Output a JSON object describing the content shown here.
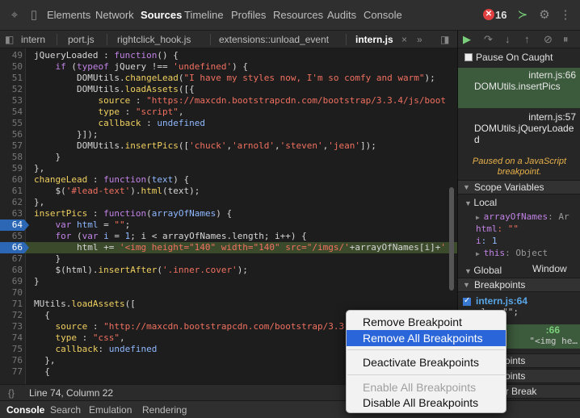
{
  "toolbar": {
    "tabs": [
      "Elements",
      "Network",
      "Sources",
      "Timeline",
      "Profiles",
      "Resources",
      "Audits",
      "Console"
    ],
    "active_tab": "Sources",
    "error_count": "16"
  },
  "file_tabs": [
    "intern",
    "port.js",
    "rightclick_hook.js",
    "extensions::unload_event",
    "intern.js"
  ],
  "active_file": "intern.js",
  "editor": {
    "lines": [
      {
        "n": "49",
        "html": "<span class='m'>jQueryLoaded</span> : <span class='k'>function</span>() {"
      },
      {
        "n": "50",
        "html": "    <span class='k'>if</span> (<span class='k'>typeof</span> jQuery !== <span class='s'>'undefined'</span>) {"
      },
      {
        "n": "51",
        "html": "        DOMUtils.<span class='p'>changeLead</span>(<span class='s'>\"I have my styles now, I'm so comfy and warm\"</span>);"
      },
      {
        "n": "52",
        "html": "        DOMUtils.<span class='p'>loadAssets</span>([{"
      },
      {
        "n": "53",
        "html": "            <span class='p'>source</span> : <span class='s'>\"https://maxcdn.bootstrapcdn.com/bootstrap/3.3.4/js/boot</span>"
      },
      {
        "n": "54",
        "html": "            <span class='p'>type</span> : <span class='s'>\"script\"</span>,"
      },
      {
        "n": "55",
        "html": "            <span class='p'>callback</span> : <span class='v'>undefined</span>"
      },
      {
        "n": "56",
        "html": "        }]);"
      },
      {
        "n": "57",
        "html": "        DOMUtils.<span class='p'>insertPics</span>([<span class='s'>'chuck'</span>,<span class='s'>'arnold'</span>,<span class='s'>'steven'</span>,<span class='s'>'jean'</span>]);"
      },
      {
        "n": "58",
        "html": "    }"
      },
      {
        "n": "59",
        "html": "},"
      },
      {
        "n": "60",
        "html": "<span class='p'>changeLead</span> : <span class='k'>function</span>(<span class='v'>text</span>) {"
      },
      {
        "n": "61",
        "html": "    $(<span class='s'>'#lead-text'</span>).<span class='p'>html</span>(text);"
      },
      {
        "n": "62",
        "html": "},"
      },
      {
        "n": "63",
        "html": "<span class='p'>insertPics</span> : <span class='k'>function</span>(<span class='v'>arrayOfNames</span>) {"
      },
      {
        "n": "64",
        "html": "    <span class='k'>var</span> <span class='v'>html</span> = <span class='s'>\"\"</span>;",
        "bp": true
      },
      {
        "n": "65",
        "html": "    <span class='k'>for</span> (<span class='k'>var</span> <span class='v'>i</span> = <span class='v'>1</span>; i &lt; arrayOfNames.length; i++) {"
      },
      {
        "n": "66",
        "html": "        html += <span class='s'>'&lt;img height=\"140\" width=\"140\" src=\"/imgs/'</span>+arrayOfNames[i]+<span class='s'>'</span>",
        "bp": true,
        "exec": true
      },
      {
        "n": "67",
        "html": "    }"
      },
      {
        "n": "68",
        "html": "    $(html).<span class='p'>insertAfter</span>(<span class='s'>'.inner.cover'</span>);"
      },
      {
        "n": "69",
        "html": "}"
      },
      {
        "n": "70",
        "html": ""
      },
      {
        "n": "71",
        "html": "MUtils.<span class='p'>loadAssets</span>(["
      },
      {
        "n": "72",
        "html": "  {"
      },
      {
        "n": "73",
        "html": "    <span class='p'>source</span> : <span class='s'>\"http://maxcdn.bootstrapcdn.com/bootstrap/3.3</span>"
      },
      {
        "n": "74",
        "html": "    <span class='p'>type</span> : <span class='s'>\"css\"</span>,"
      },
      {
        "n": "75",
        "html": "    <span class='p'>callback</span>: <span class='v'>undefined</span>"
      },
      {
        "n": "76",
        "html": "  },"
      },
      {
        "n": "77",
        "html": "  {"
      }
    ]
  },
  "status": {
    "braces": "{}",
    "position": "Line 74, Column 22"
  },
  "drawer_tabs": [
    "Console",
    "Search",
    "Emulation",
    "Rendering"
  ],
  "sidebar": {
    "pause_caught": "Pause On Caught",
    "call_frames": [
      {
        "loc": "intern.js:66",
        "fn": "DOMUtils.insertPics",
        "selected": true
      },
      {
        "loc": "intern.js:57",
        "fn": "DOMUtils.jQueryLoaded",
        "selected": false
      }
    ],
    "paused_message": "Paused on a JavaScript breakpoint.",
    "scope_variables": "Scope Variables",
    "local": "Local",
    "scope_rows": [
      {
        "key": "arrayOfNames",
        "val": ": Ar",
        "cls": "obj",
        "expand": true
      },
      {
        "key": "html",
        "val": ": \"\"",
        "cls": "str"
      },
      {
        "key": "i",
        "val": ": 1",
        "cls": "num"
      },
      {
        "key": "this",
        "val": ": Object",
        "cls": "obj",
        "expand": true
      }
    ],
    "global": "Global",
    "global_val": "Window",
    "breakpoints": "Breakpoints",
    "bp_items": [
      {
        "file": "intern.js:64",
        "src": "ml = \"\";"
      },
      {
        "file": ":66",
        "src": "\"<img he…"
      }
    ],
    "extra_heads": [
      "Breakpoints",
      "Breakpoints",
      "Listener Break"
    ]
  },
  "context_menu": {
    "items": [
      {
        "label": "Remove Breakpoint",
        "state": "normal"
      },
      {
        "label": "Remove All Breakpoints",
        "state": "hover"
      },
      {
        "label": "Deactivate Breakpoints",
        "state": "normal"
      },
      {
        "label": "Enable All Breakpoints",
        "state": "disabled"
      },
      {
        "label": "Disable All Breakpoints",
        "state": "normal"
      }
    ]
  }
}
